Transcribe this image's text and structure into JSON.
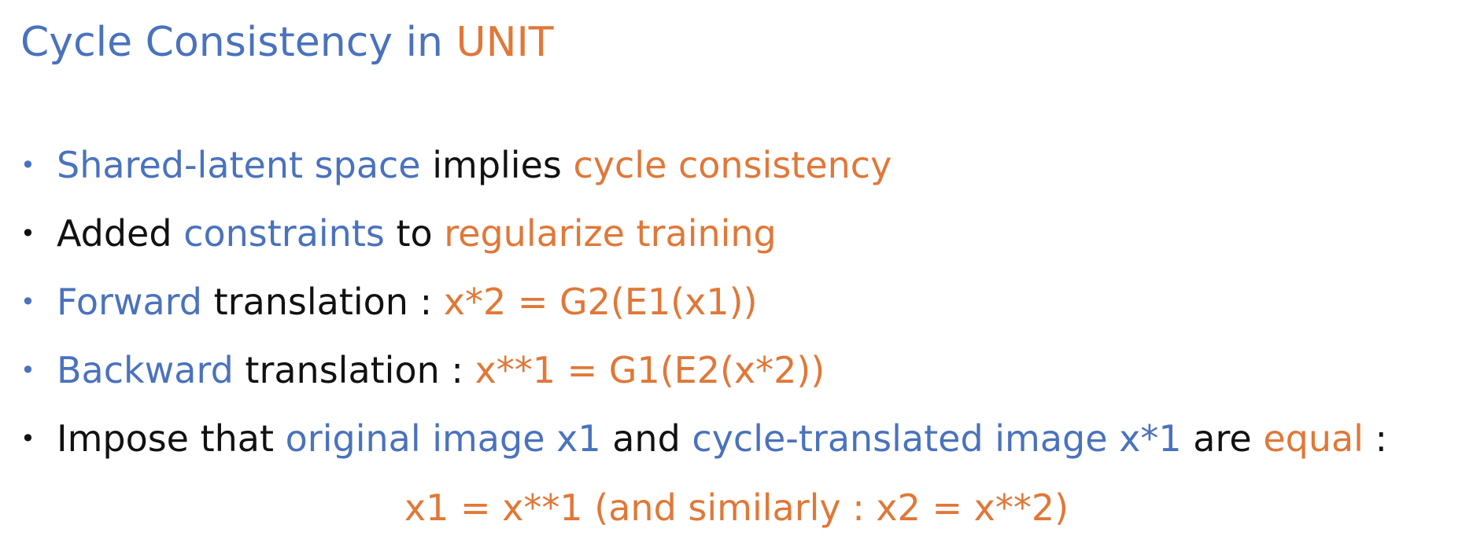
{
  "title": {
    "part1": "Cycle Consistency in ",
    "part2": "UNIT"
  },
  "bullets": [
    {
      "dot": "•",
      "segments": [
        "Shared-latent space",
        " implies ",
        "cycle consistency"
      ]
    },
    {
      "dot": "•",
      "segments": [
        "Added ",
        "constraints",
        " to ",
        "regularize training"
      ]
    },
    {
      "dot": "•",
      "segments": [
        "Forward",
        " translation : ",
        "x*2 = G2(E1(x1))"
      ]
    },
    {
      "dot": "•",
      "segments": [
        "Backward",
        " translation : ",
        "x**1 = G1(E2(x*2))"
      ]
    },
    {
      "dot": "•",
      "segments": [
        "Impose that ",
        "original image x1",
        " and ",
        "cycle-translated image x*1",
        " are ",
        "equal",
        " :"
      ]
    }
  ],
  "equation": "x1 = x**1 (and similarly : x2 = x**2)",
  "colors": {
    "blue": "#4a72bd",
    "orange": "#e07838",
    "black": "#111111",
    "background": "#ffffff"
  }
}
